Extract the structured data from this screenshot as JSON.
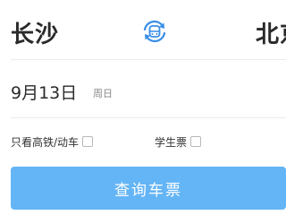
{
  "route": {
    "from_station": "长沙",
    "to_station": "北京"
  },
  "swap_icon": "swap-stations-icon",
  "date": {
    "value": "9月13日",
    "weekday": "周日"
  },
  "options": [
    {
      "label": "只看高铁/动车",
      "checked": false
    },
    {
      "label": "学生票",
      "checked": false
    }
  ],
  "query_button": {
    "label": "查询车票"
  },
  "colors": {
    "accent": "#64b5f6",
    "icon_blue": "#3a8ee6",
    "divider": "#ececec",
    "text_primary": "#2a2a2a",
    "text_secondary": "#888888"
  }
}
